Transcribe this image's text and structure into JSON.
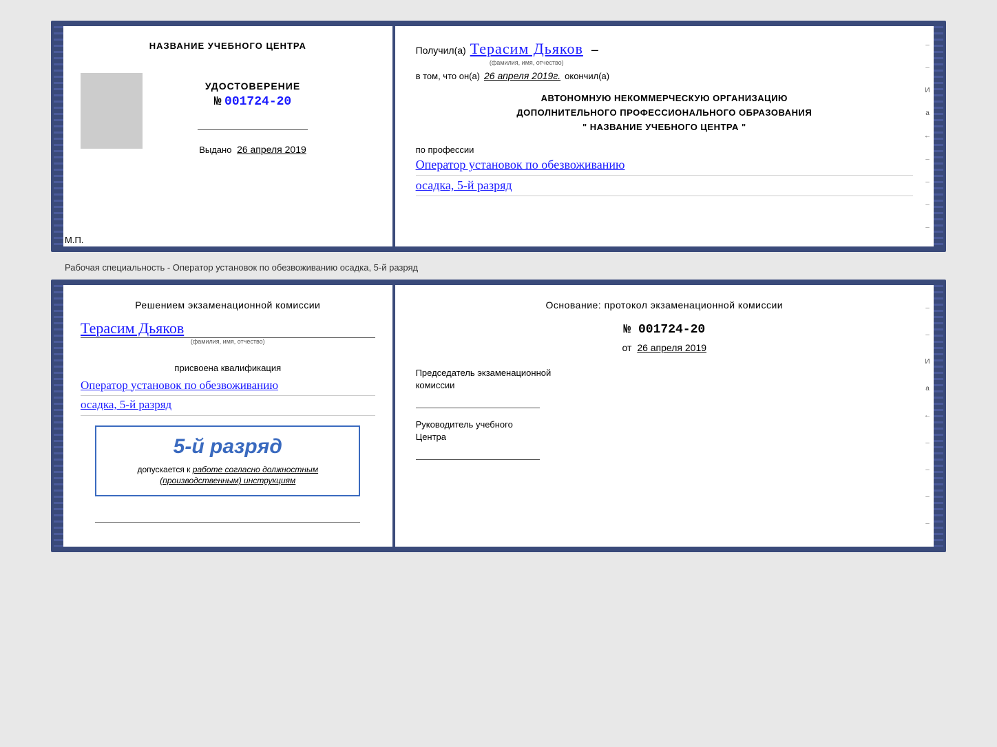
{
  "top_doc": {
    "left": {
      "school_name": "НАЗВАНИЕ УЧЕБНОГО ЦЕНТРА",
      "cert_label": "УДОСТОВЕРЕНИЕ",
      "cert_number_prefix": "№",
      "cert_number": "001724-20",
      "issued_label": "Выдано",
      "issued_date": "26 апреля 2019",
      "mp_label": "М.П."
    },
    "right": {
      "received_label": "Получил(а)",
      "recipient_name": "Терасим Дьяков",
      "fio_sublabel": "(фамилия, имя, отчество)",
      "dash": "–",
      "in_that_label": "в том, что он(а)",
      "completion_date": "26 апреля 2019г.",
      "completed_label": "окончил(а)",
      "org_line1": "АВТОНОМНУЮ НЕКОММЕРЧЕСКУЮ ОРГАНИЗАЦИЮ",
      "org_line2": "ДОПОЛНИТЕЛЬНОГО ПРОФЕССИОНАЛЬНОГО ОБРАЗОВАНИЯ",
      "org_line3": "\"   НАЗВАНИЕ УЧЕБНОГО ЦЕНТРА   \"",
      "profession_label": "по профессии",
      "profession_value": "Оператор установок по обезвоживанию",
      "rank_value": "осадка, 5-й разряд"
    }
  },
  "separator": {
    "text": "Рабочая специальность - Оператор установок по обезвоживанию осадка, 5-й разряд"
  },
  "bottom_doc": {
    "left": {
      "decision_text": "Решением экзаменационной комиссии",
      "person_name": "Терасим Дьяков",
      "fio_sublabel": "(фамилия, имя, отчество)",
      "qualified_label": "присвоена квалификация",
      "qualification_line1": "Оператор установок по обезвоживанию",
      "qualification_line2": "осадка, 5-й разряд",
      "rank_box_text": "5-й разряд",
      "admit_prefix": "допускается к",
      "admit_text_underline": "работе согласно должностным",
      "admit_text2": "(производственным) инструкциям"
    },
    "right": {
      "basis_title": "Основание: протокол экзаменационной комиссии",
      "protocol_prefix": "№",
      "protocol_number": "001724-20",
      "date_prefix": "от",
      "protocol_date": "26 апреля 2019",
      "chairman_label": "Председатель экзаменационной",
      "chairman_label2": "комиссии",
      "director_label": "Руководитель учебного",
      "director_label2": "Центра"
    }
  },
  "side_marks": {
    "dashes": [
      "-",
      "-",
      "И",
      "а",
      "←",
      "-",
      "-",
      "-",
      "-"
    ]
  }
}
